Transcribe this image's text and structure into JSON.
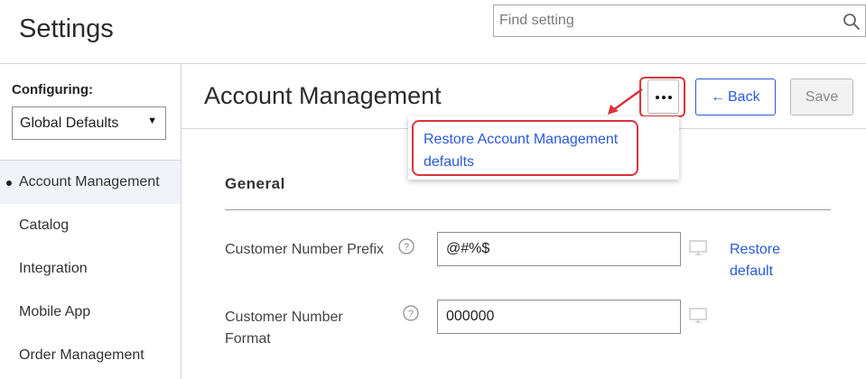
{
  "header": {
    "title": "Settings",
    "search": {
      "placeholder": "Find setting",
      "value": ""
    }
  },
  "sidebar": {
    "configuring_label": "Configuring:",
    "scope_selected": "Global Defaults",
    "items": [
      {
        "label": "Account Management",
        "active": true
      },
      {
        "label": "Catalog",
        "active": false
      },
      {
        "label": "Integration",
        "active": false
      },
      {
        "label": "Mobile App",
        "active": false
      },
      {
        "label": "Order Management",
        "active": false
      }
    ]
  },
  "main": {
    "title": "Account Management",
    "more_icon": "more-horizontal-icon",
    "back_label": "Back",
    "save_label": "Save",
    "more_menu": {
      "items": [
        {
          "label": "Restore Account Management defaults"
        }
      ]
    },
    "section": {
      "title": "General",
      "fields": [
        {
          "label": "Customer Number Prefix",
          "value": "@#%$",
          "restore_label": "Restore default"
        },
        {
          "label": "Customer Number Format",
          "value": "000000"
        }
      ]
    }
  },
  "annotations": {
    "highlight_color": "#d9353a"
  },
  "colors": {
    "link": "#2a5bd7",
    "border": "#d6d6d6",
    "active_bg": "#f1f3f8"
  }
}
